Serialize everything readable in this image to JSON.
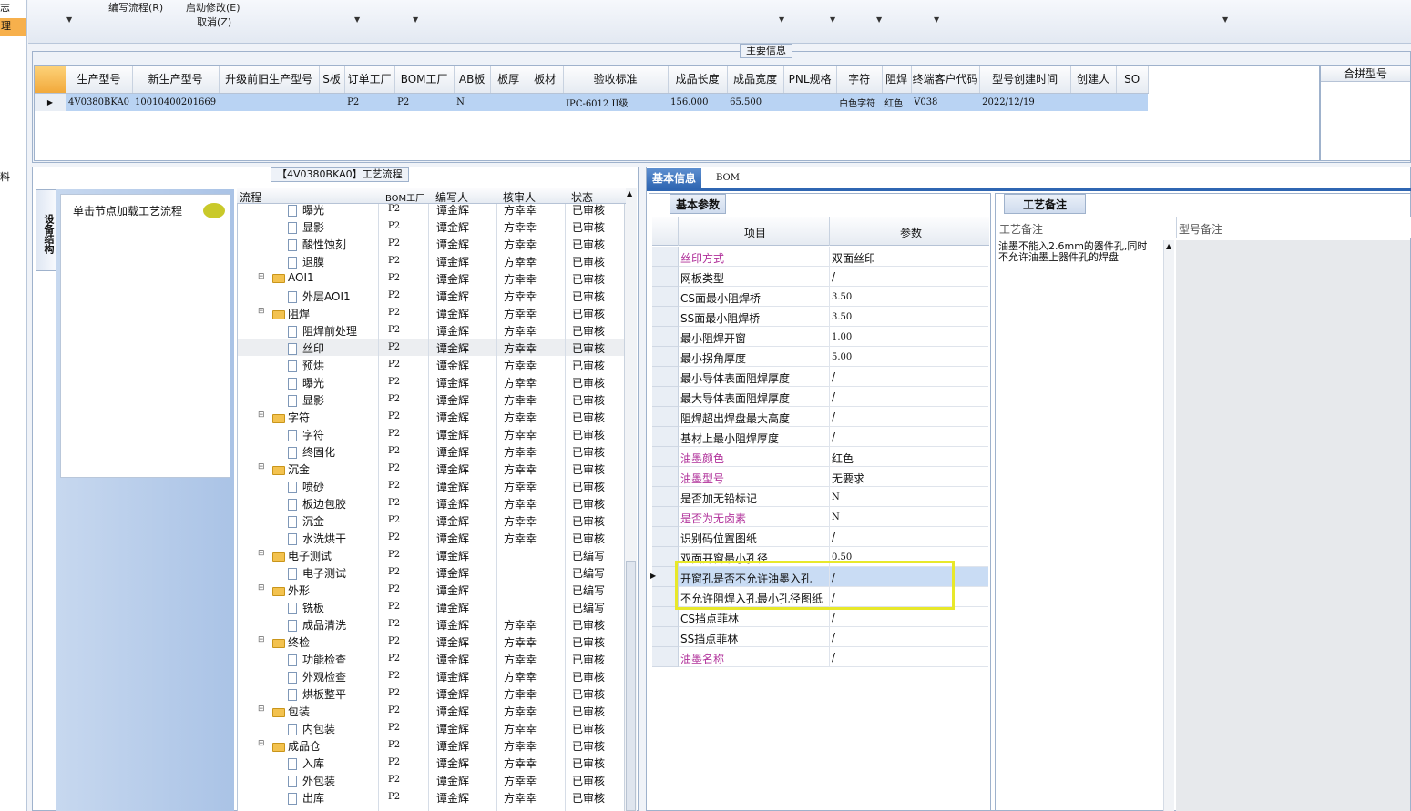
{
  "left_strip": {
    "item1": "志",
    "item2": "理",
    "item3": "料"
  },
  "menu": {
    "item1": "编写流程(R)",
    "item2": "启动修改(E)",
    "item3": "取消(Z)"
  },
  "main_info": {
    "legend": "主要信息",
    "columns": [
      "生产型号",
      "新生产型号",
      "升级前旧生产型号",
      "S板",
      "订单工厂",
      "BOM工厂",
      "AB板",
      "板厚",
      "板材",
      "验收标准",
      "成品长度",
      "成品宽度",
      "PNL规格",
      "字符",
      "阻焊",
      "终端客户代码",
      "型号创建时间",
      "创建人",
      "SO"
    ],
    "row": [
      "4V0380BKA0",
      "10010400201669",
      "",
      "",
      "P2",
      "P2",
      "N",
      "",
      "",
      "IPC-6012 II级",
      "156.000",
      "65.500",
      "",
      "白色字符",
      "红色",
      "V038",
      "2022/12/19",
      "",
      ""
    ],
    "merge_header": "合拼型号"
  },
  "process": {
    "legend": "【4V0380BKA0】工艺流程",
    "side_tab": "设备结构",
    "hint": "单击节点加载工艺流程",
    "columns": [
      "流程",
      "BOM工厂",
      "编写人",
      "核审人",
      "状态"
    ],
    "rows": [
      {
        "name": "曝光",
        "level": 2,
        "bom": "P2",
        "writer": "谭金辉",
        "reviewer": "方幸幸",
        "status": "已审核"
      },
      {
        "name": "显影",
        "level": 2,
        "bom": "P2",
        "writer": "谭金辉",
        "reviewer": "方幸幸",
        "status": "已审核"
      },
      {
        "name": "酸性蚀刻",
        "level": 2,
        "bom": "P2",
        "writer": "谭金辉",
        "reviewer": "方幸幸",
        "status": "已审核"
      },
      {
        "name": "退膜",
        "level": 2,
        "bom": "P2",
        "writer": "谭金辉",
        "reviewer": "方幸幸",
        "status": "已审核"
      },
      {
        "name": "AOI1",
        "level": 1,
        "bom": "P2",
        "writer": "谭金辉",
        "reviewer": "方幸幸",
        "status": "已审核"
      },
      {
        "name": "外层AOI1",
        "level": 2,
        "bom": "P2",
        "writer": "谭金辉",
        "reviewer": "方幸幸",
        "status": "已审核"
      },
      {
        "name": "阻焊",
        "level": 1,
        "bom": "P2",
        "writer": "谭金辉",
        "reviewer": "方幸幸",
        "status": "已审核"
      },
      {
        "name": "阻焊前处理",
        "level": 2,
        "bom": "P2",
        "writer": "谭金辉",
        "reviewer": "方幸幸",
        "status": "已审核"
      },
      {
        "name": "丝印",
        "level": 2,
        "bom": "P2",
        "writer": "谭金辉",
        "reviewer": "方幸幸",
        "status": "已审核",
        "selected": true
      },
      {
        "name": "预烘",
        "level": 2,
        "bom": "P2",
        "writer": "谭金辉",
        "reviewer": "方幸幸",
        "status": "已审核"
      },
      {
        "name": "曝光",
        "level": 2,
        "bom": "P2",
        "writer": "谭金辉",
        "reviewer": "方幸幸",
        "status": "已审核"
      },
      {
        "name": "显影",
        "level": 2,
        "bom": "P2",
        "writer": "谭金辉",
        "reviewer": "方幸幸",
        "status": "已审核"
      },
      {
        "name": "字符",
        "level": 1,
        "bom": "P2",
        "writer": "谭金辉",
        "reviewer": "方幸幸",
        "status": "已审核"
      },
      {
        "name": "字符",
        "level": 2,
        "bom": "P2",
        "writer": "谭金辉",
        "reviewer": "方幸幸",
        "status": "已审核"
      },
      {
        "name": "终固化",
        "level": 2,
        "bom": "P2",
        "writer": "谭金辉",
        "reviewer": "方幸幸",
        "status": "已审核"
      },
      {
        "name": "沉金",
        "level": 1,
        "bom": "P2",
        "writer": "谭金辉",
        "reviewer": "方幸幸",
        "status": "已审核"
      },
      {
        "name": "喷砂",
        "level": 2,
        "bom": "P2",
        "writer": "谭金辉",
        "reviewer": "方幸幸",
        "status": "已审核"
      },
      {
        "name": "板边包胶",
        "level": 2,
        "bom": "P2",
        "writer": "谭金辉",
        "reviewer": "方幸幸",
        "status": "已审核"
      },
      {
        "name": "沉金",
        "level": 2,
        "bom": "P2",
        "writer": "谭金辉",
        "reviewer": "方幸幸",
        "status": "已审核"
      },
      {
        "name": "水洗烘干",
        "level": 2,
        "bom": "P2",
        "writer": "谭金辉",
        "reviewer": "方幸幸",
        "status": "已审核"
      },
      {
        "name": "电子测试",
        "level": 1,
        "bom": "P2",
        "writer": "谭金辉",
        "reviewer": "",
        "status": "已编写"
      },
      {
        "name": "电子测试",
        "level": 2,
        "bom": "P2",
        "writer": "谭金辉",
        "reviewer": "",
        "status": "已编写"
      },
      {
        "name": "外形",
        "level": 1,
        "bom": "P2",
        "writer": "谭金辉",
        "reviewer": "",
        "status": "已编写"
      },
      {
        "name": "铣板",
        "level": 2,
        "bom": "P2",
        "writer": "谭金辉",
        "reviewer": "",
        "status": "已编写"
      },
      {
        "name": "成品清洗",
        "level": 2,
        "bom": "P2",
        "writer": "谭金辉",
        "reviewer": "方幸幸",
        "status": "已审核"
      },
      {
        "name": "终检",
        "level": 1,
        "bom": "P2",
        "writer": "谭金辉",
        "reviewer": "方幸幸",
        "status": "已审核"
      },
      {
        "name": "功能检查",
        "level": 2,
        "bom": "P2",
        "writer": "谭金辉",
        "reviewer": "方幸幸",
        "status": "已审核"
      },
      {
        "name": "外观检查",
        "level": 2,
        "bom": "P2",
        "writer": "谭金辉",
        "reviewer": "方幸幸",
        "status": "已审核"
      },
      {
        "name": "烘板整平",
        "level": 2,
        "bom": "P2",
        "writer": "谭金辉",
        "reviewer": "方幸幸",
        "status": "已审核"
      },
      {
        "name": "包装",
        "level": 1,
        "bom": "P2",
        "writer": "谭金辉",
        "reviewer": "方幸幸",
        "status": "已审核"
      },
      {
        "name": "内包装",
        "level": 2,
        "bom": "P2",
        "writer": "谭金辉",
        "reviewer": "方幸幸",
        "status": "已审核"
      },
      {
        "name": "成品仓",
        "level": 1,
        "bom": "P2",
        "writer": "谭金辉",
        "reviewer": "方幸幸",
        "status": "已审核"
      },
      {
        "name": "入库",
        "level": 2,
        "bom": "P2",
        "writer": "谭金辉",
        "reviewer": "方幸幸",
        "status": "已审核"
      },
      {
        "name": "外包装",
        "level": 2,
        "bom": "P2",
        "writer": "谭金辉",
        "reviewer": "方幸幸",
        "status": "已审核"
      },
      {
        "name": "出库",
        "level": 2,
        "bom": "P2",
        "writer": "谭金辉",
        "reviewer": "方幸幸",
        "status": "已审核"
      }
    ]
  },
  "right": {
    "tab_basic": "基本信息",
    "tab_bom": "BOM",
    "basic_params_tab": "基本参数",
    "col_item": "项目",
    "col_param": "参数",
    "process_note_tab": "工艺备注",
    "note_col1": "工艺备注",
    "note_col2": "型号备注",
    "note_text_1": "油墨不能入2.6mm的器件孔,同时",
    "note_text_2": "不允许油墨上器件孔的焊盘",
    "params": [
      {
        "k": "丝印方式",
        "v": "双面丝印",
        "mag": true
      },
      {
        "k": "网板类型",
        "v": "/",
        "mag": false
      },
      {
        "k": "CS面最小阻焊桥",
        "v": "3.50",
        "mag": false
      },
      {
        "k": "SS面最小阻焊桥",
        "v": "3.50",
        "mag": false
      },
      {
        "k": "最小阻焊开窗",
        "v": "1.00",
        "mag": false
      },
      {
        "k": "最小拐角厚度",
        "v": "5.00",
        "mag": false
      },
      {
        "k": "最小导体表面阻焊厚度",
        "v": "/",
        "mag": false
      },
      {
        "k": "最大导体表面阻焊厚度",
        "v": "/",
        "mag": false
      },
      {
        "k": "阻焊超出焊盘最大高度",
        "v": "/",
        "mag": false
      },
      {
        "k": "基材上最小阻焊厚度",
        "v": "/",
        "mag": false
      },
      {
        "k": "油墨颜色",
        "v": "红色",
        "mag": true
      },
      {
        "k": "油墨型号",
        "v": "无要求",
        "mag": true
      },
      {
        "k": "是否加无铅标记",
        "v": "N",
        "mag": false
      },
      {
        "k": "是否为无卤素",
        "v": "N",
        "mag": true
      },
      {
        "k": "识别码位置图纸",
        "v": "/",
        "mag": false
      },
      {
        "k": "双面开窗最小孔径",
        "v": "0.50",
        "mag": false
      },
      {
        "k": "开窗孔是否不允许油墨入孔",
        "v": "/",
        "mag": false,
        "selected": true
      },
      {
        "k": "不允许阻焊入孔最小孔径图纸",
        "v": "/",
        "mag": false
      },
      {
        "k": "CS挡点菲林",
        "v": "/",
        "mag": false
      },
      {
        "k": "SS挡点菲林",
        "v": "/",
        "mag": false
      },
      {
        "k": "油墨名称",
        "v": "/",
        "mag": true
      }
    ]
  }
}
